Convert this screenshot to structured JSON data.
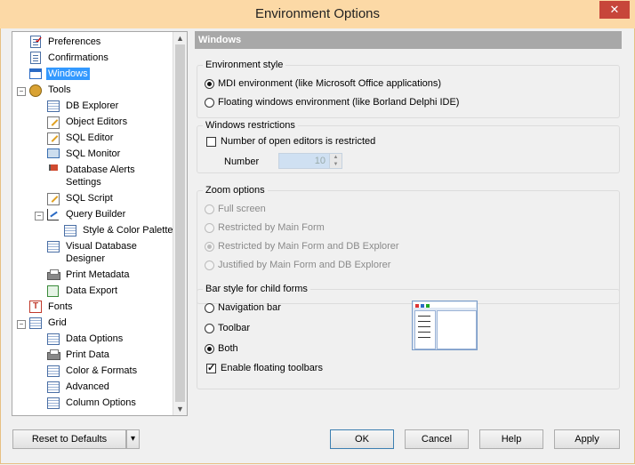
{
  "window": {
    "title": "Environment Options",
    "close_label": "✕"
  },
  "tree": {
    "items": [
      {
        "label": "Preferences"
      },
      {
        "label": "Confirmations"
      },
      {
        "label": "Windows"
      },
      {
        "label": "Tools"
      },
      {
        "label": "DB Explorer"
      },
      {
        "label": "Object Editors"
      },
      {
        "label": "SQL Editor"
      },
      {
        "label": "SQL Monitor"
      },
      {
        "label": "Database Alerts Settings"
      },
      {
        "label": "SQL Script"
      },
      {
        "label": "Query Builder"
      },
      {
        "label": "Style & Color Palette"
      },
      {
        "label": "Visual Database Designer"
      },
      {
        "label": "Print Metadata"
      },
      {
        "label": "Data Export"
      },
      {
        "label": "Fonts"
      },
      {
        "label": "Grid"
      },
      {
        "label": "Data Options"
      },
      {
        "label": "Print Data"
      },
      {
        "label": "Color & Formats"
      },
      {
        "label": "Advanced"
      },
      {
        "label": "Column Options"
      }
    ],
    "selected": "Windows"
  },
  "panel": {
    "header": "Windows",
    "environment_style": {
      "title": "Environment style",
      "options": [
        "MDI environment (like Microsoft Office applications)",
        "Floating windows environment (like Borland Delphi IDE)"
      ],
      "selected_index": 0
    },
    "windows_restrictions": {
      "title": "Windows restrictions",
      "checkbox_label": "Number of open editors is restricted",
      "checked": false,
      "number_label": "Number",
      "number_value": "10"
    },
    "zoom_options": {
      "title": "Zoom options",
      "options": [
        "Full screen",
        "Restricted by Main Form",
        "Restricted by Main Form and DB Explorer",
        "Justified by Main Form and DB Explorer"
      ],
      "selected_index": 2,
      "disabled": true
    },
    "bar_style": {
      "title": "Bar style for child forms",
      "options": [
        "Navigation bar",
        "Toolbar",
        "Both"
      ],
      "selected_index": 2,
      "floating_label": "Enable floating toolbars",
      "floating_checked": true
    }
  },
  "buttons": {
    "reset": "Reset to Defaults",
    "reset_arrow": "▾",
    "ok": "OK",
    "cancel": "Cancel",
    "help": "Help",
    "apply": "Apply"
  }
}
